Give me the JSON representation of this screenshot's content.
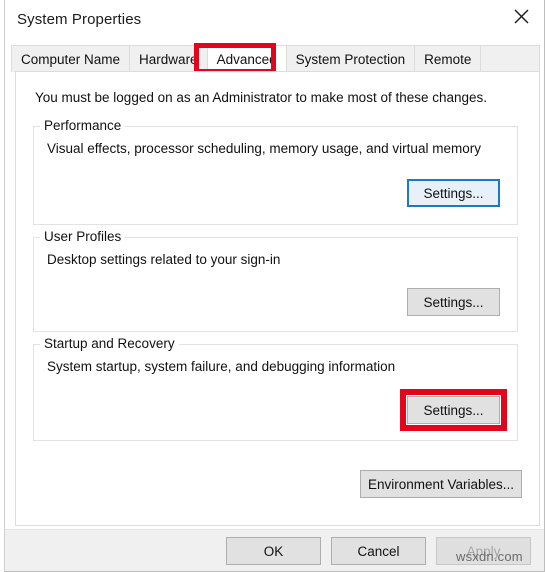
{
  "window": {
    "title": "System Properties",
    "close_icon": "close-icon"
  },
  "tabs": [
    {
      "label": "Computer Name",
      "selected": false
    },
    {
      "label": "Hardware",
      "selected": false
    },
    {
      "label": "Advanced",
      "selected": true
    },
    {
      "label": "System Protection",
      "selected": false
    },
    {
      "label": "Remote",
      "selected": false
    }
  ],
  "content": {
    "intro": "You must be logged on as an Administrator to make most of these changes.",
    "groups": [
      {
        "legend": "Performance",
        "description": "Visual effects, processor scheduling, memory usage, and virtual memory",
        "button": "Settings..."
      },
      {
        "legend": "User Profiles",
        "description": "Desktop settings related to your sign-in",
        "button": "Settings..."
      },
      {
        "legend": "Startup and Recovery",
        "description": "System startup, system failure, and debugging information",
        "button": "Settings..."
      }
    ],
    "environment_variables_button": "Environment Variables..."
  },
  "footer": {
    "ok": "OK",
    "cancel": "Cancel",
    "apply": "Apply"
  },
  "watermark": "wsxdn.com",
  "colors": {
    "annotation_red": "#e3051b",
    "focus_blue": "#1a7bc4",
    "button_face": "#e1e1e1",
    "panel_bg": "#ffffff",
    "chrome_bg": "#f0f0f0"
  }
}
